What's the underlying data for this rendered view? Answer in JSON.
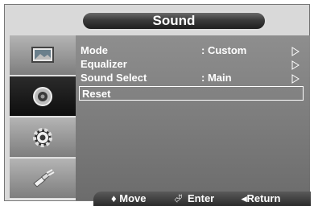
{
  "menu": {
    "title": "Sound",
    "sidebar": [
      {
        "icon": "picture-icon",
        "active": false
      },
      {
        "icon": "sound-icon",
        "active": true
      },
      {
        "icon": "setup-gear-icon",
        "active": false
      },
      {
        "icon": "input-plug-icon",
        "active": false
      }
    ],
    "items": [
      {
        "label": "Mode",
        "value": ": Custom",
        "has_arrow": true
      },
      {
        "label": "Equalizer",
        "value": "",
        "has_arrow": true
      },
      {
        "label": "Sound Select",
        "value": ": Main",
        "has_arrow": true
      },
      {
        "label": "Reset",
        "value": "",
        "has_arrow": false,
        "selected": true
      }
    ]
  },
  "help": {
    "move": "♦ Move",
    "enter_icon": "⮰",
    "enter": "Enter",
    "return": "◂Return"
  }
}
